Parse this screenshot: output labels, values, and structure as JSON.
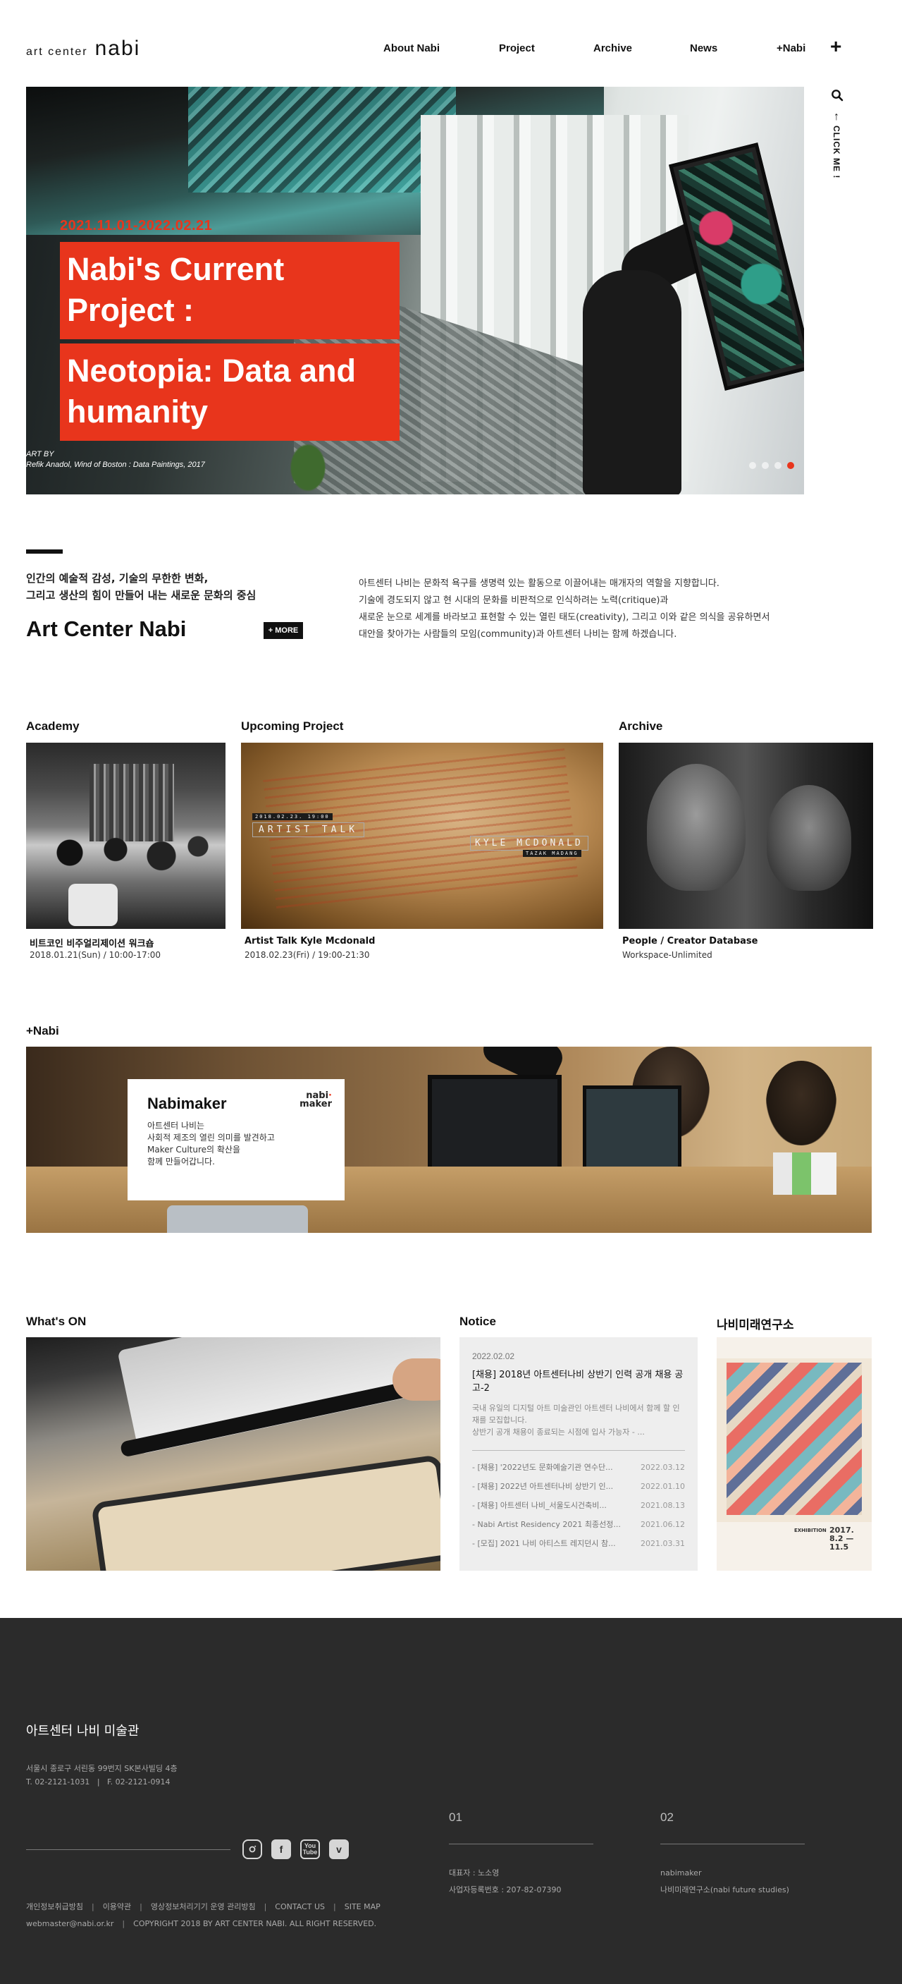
{
  "logo": {
    "small": "art center",
    "big": "nabi"
  },
  "nav": [
    "About Nabi",
    "Project",
    "Archive",
    "News",
    "+Nabi"
  ],
  "header": {
    "plus": "+"
  },
  "side_rail": {
    "arrow": "↑",
    "click_me": "CLICK ME !"
  },
  "hero": {
    "date": "2021.11.01-2022.02.21",
    "title_line1": "Nabi's Current Project :",
    "title_line2": "Neotopia: Data and humanity",
    "credit_label": "ART BY",
    "credit": "Refik Anadol, Wind of Boston : Data Paintings, 2017",
    "slide_count": 4,
    "active_slide": 4
  },
  "intro": {
    "tagline": "인간의 예술적 감성, 기술의 무한한 변화,\n그리고 생산의 힘이 만들어 내는 새로운 문화의 중심",
    "name": "Art Center Nabi",
    "more": "+ MORE",
    "description": "아트센터 나비는 문화적 욕구를 생명력 있는 활동으로 이끌어내는 매개자의 역할을 지향합니다.\n기술에 경도되지 않고 현 시대의 문화를 비판적으로 인식하려는 노력(critique)과\n새로운 눈으로 세계를 바라보고 표현할 수 있는 열린 태도(creativity), 그리고 이와 같은 의식을 공유하면서\n대안을 찾아가는 사람들의 모임(community)과 아트센터 나비는 함께 하겠습니다."
  },
  "academy": {
    "heading": "Academy",
    "title": "비트코인 비주얼리제이션 워크숍",
    "date": "2018.01.21(Sun) / 10:00-17:00"
  },
  "upcoming": {
    "heading": "Upcoming Project",
    "title": "Artist Talk Kyle Mcdonald",
    "date": "2018.02.23(Fri) / 19:00-21:30",
    "img_date": "2018.02.23. 19:00",
    "img_talk": "ARTIST TALK",
    "img_name": "KYLE MCDONALD",
    "img_sub": "TAZAK MADANG"
  },
  "archive": {
    "heading": "Archive",
    "title": "People / Creator Database",
    "date": "Workspace-Unlimited"
  },
  "plus_nabi": {
    "heading": "+Nabi",
    "card_title": "Nabimaker",
    "card_text": "아트센터 나비는\n사회적 제조의 열린 의미를 발견하고\nMaker Culture의 확산을\n함께 만들어갑니다.",
    "logo_line1": "nabi",
    "logo_line2": "maker"
  },
  "whats_on": {
    "heading": "What's ON"
  },
  "notice": {
    "heading": "Notice",
    "date": "2022.02.02",
    "title": "[채용] 2018년 아트센터나비 상반기 인력 공개 채용 공고-2",
    "body": "국내 유일의 디지털 아트 미술관인 아트센터 나비에서 함께 할 인재를 모집합니다.\n상반기 공개 채용이 종료되는 시점에 입사 가능자 - ...",
    "items": [
      {
        "title": "- [채용] '2022년도 문화예술기관 연수단...",
        "date": "2022.03.12"
      },
      {
        "title": "- [채용] 2022년 아트센터나비 상반기 인...",
        "date": "2022.01.10"
      },
      {
        "title": "- [채용] 아트센터 나비_서울도시건축비...",
        "date": "2021.08.13"
      },
      {
        "title": "- Nabi Artist Residency 2021 최종선정...",
        "date": "2021.06.12"
      },
      {
        "title": "- [모집] 2021 나비 아티스트 레지던시 참...",
        "date": "2021.03.31"
      }
    ]
  },
  "future_lab": {
    "heading": "나비미래연구소",
    "poster_exhibition": "EXHIBITION",
    "poster_dates": "2017.\n8.2 — 11.5"
  },
  "footer": {
    "name": "아트센터 나비 미술관",
    "address": "서울시 종로구 서린동 99번지 SK본사빌딩 4층",
    "phone": "T. 02-2121-1031   |   F. 02-2121-0914",
    "social": [
      "instagram-icon",
      "facebook-icon",
      "youtube-icon",
      "vimeo-icon"
    ],
    "links": [
      "개인정보취급방침",
      "이용약관",
      "영상정보처리기기 운영 관리방침",
      "CONTACT US",
      "SITE MAP"
    ],
    "email": "webmaster@nabi.or.kr",
    "copyright": "COPYRIGHT 2018 BY ART CENTER NABI. ALL RIGHT RESERVED.",
    "col1_num": "01",
    "col1_line1": "대표자 : 노소영",
    "col1_line2": "사업자등록번호 : 207-82-07390",
    "col2_num": "02",
    "col2_line1": "nabimaker",
    "col2_line2": "나비미래연구소(nabi future studies)"
  },
  "colors": {
    "accent": "#e8351c",
    "footer_bg": "#2b2b2b",
    "notice_bg": "#eeeeee"
  }
}
